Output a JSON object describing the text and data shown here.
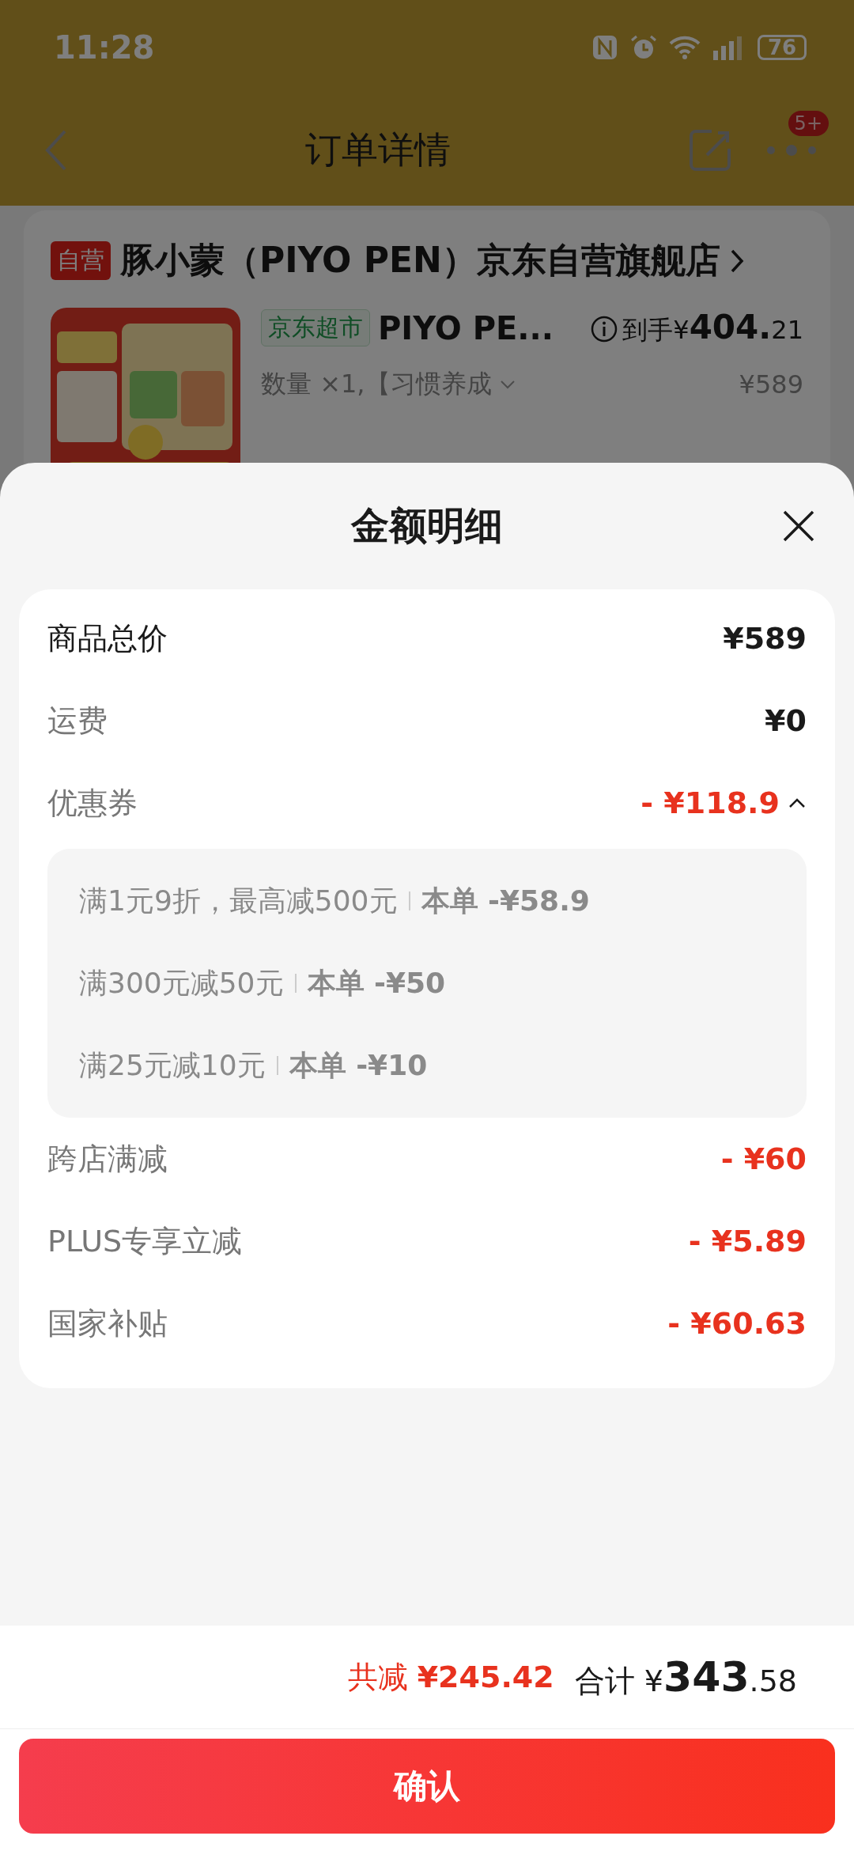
{
  "status_bar": {
    "time": "11:28",
    "battery": "76"
  },
  "nav": {
    "title": "订单详情",
    "badge": "5+"
  },
  "shop": {
    "tag": "自营",
    "name": "豚小蒙（PIYO PEN）京东自营旗舰店"
  },
  "product": {
    "tag": "京东超市",
    "name": "PIYO PE...",
    "price_prefix": "到手¥",
    "price_integer": "404.",
    "price_decimal": "21",
    "spec": "数量 ×1,【习惯养成",
    "original_price": "¥589"
  },
  "sheet": {
    "title": "金额明细",
    "rows": [
      {
        "kind": "total",
        "label": "商品总价",
        "value": "¥589"
      },
      {
        "kind": "fee",
        "label": "运费",
        "value": "¥0"
      },
      {
        "kind": "coupon",
        "label": "优惠券",
        "value": "- ¥118.9",
        "expanded": true,
        "items": [
          {
            "rule": "满1元9折，最高减500元",
            "applied": "本单 -¥58.9"
          },
          {
            "rule": "满300元减50元",
            "applied": "本单 -¥50"
          },
          {
            "rule": "满25元减10元",
            "applied": "本单 -¥10"
          }
        ]
      },
      {
        "kind": "discount",
        "label": "跨店满减",
        "value": "- ¥60"
      },
      {
        "kind": "discount",
        "label": "PLUS专享立减",
        "value": "- ¥5.89"
      },
      {
        "kind": "discount",
        "label": "国家补贴",
        "value": "- ¥60.63"
      }
    ]
  },
  "footer": {
    "discount_label": "共减",
    "discount_value": "¥245.42",
    "total_label": "合计",
    "total_currency": "¥",
    "total_integer": "343",
    "total_decimal": ".58",
    "confirm": "确认"
  }
}
